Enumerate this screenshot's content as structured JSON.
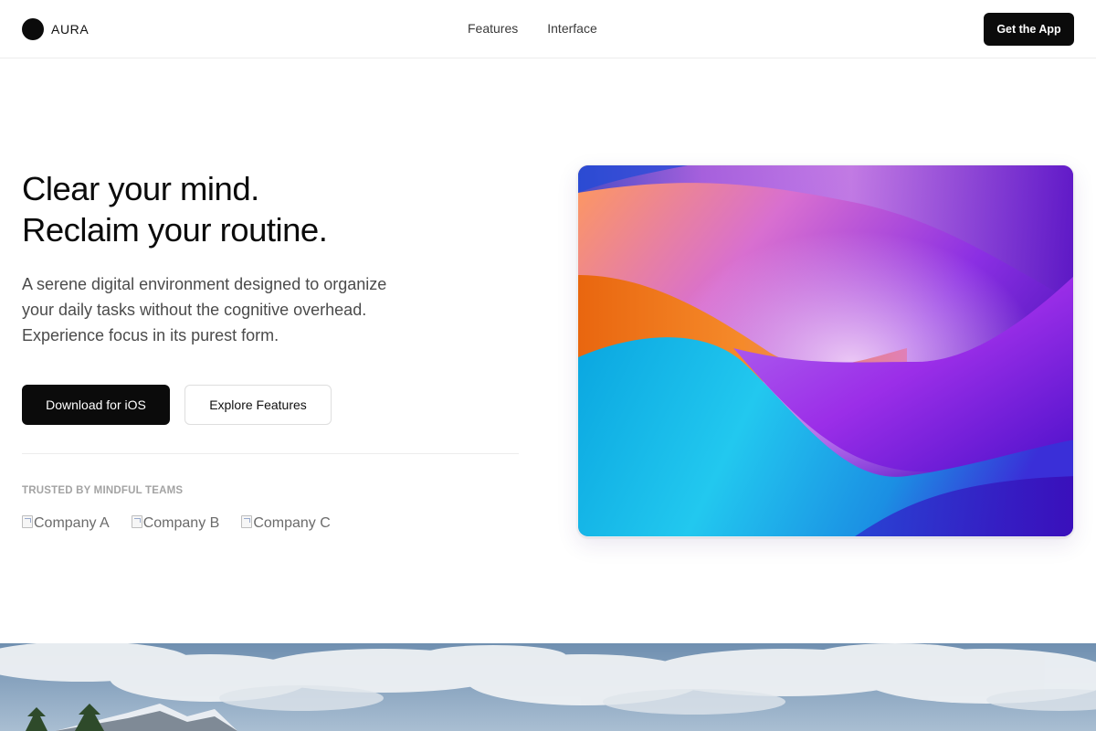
{
  "header": {
    "brand": "AURA",
    "nav": [
      "Features",
      "Interface"
    ],
    "cta": "Get the App"
  },
  "hero": {
    "title_line1": "Clear your mind.",
    "title_line2": "Reclaim your routine.",
    "subtitle_line1": "A serene digital environment designed to organize",
    "subtitle_line2": "your daily tasks without the cognitive overhead.",
    "subtitle_line3": "Experience focus in its purest form.",
    "primary_button": "Download for iOS",
    "secondary_button": "Explore Features",
    "trusted_label": "TRUSTED BY MINDFUL TEAMS",
    "logos": [
      "Company A",
      "Company B",
      "Company C"
    ]
  },
  "icons": {
    "brand_mark": "black-circle-icon",
    "logo_placeholder": "broken-image-icon"
  },
  "colors": {
    "primary": "#0b0b0b",
    "background": "#ffffff",
    "muted_text": "#4b4b4b",
    "label_gray": "#a3a3a3"
  }
}
